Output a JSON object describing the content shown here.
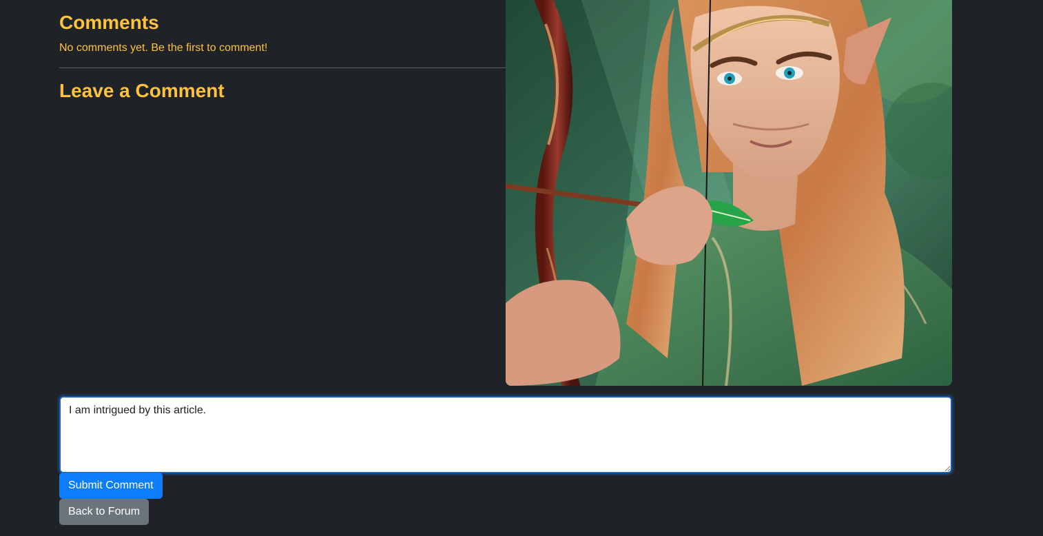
{
  "comments": {
    "title": "Comments",
    "empty_message": "No comments yet. Be the first to comment!"
  },
  "leave_comment": {
    "title": "Leave a Comment",
    "textarea_value": "I am intrigued by this article."
  },
  "buttons": {
    "submit_label": "Submit Comment",
    "back_label": "Back to Forum"
  },
  "colors": {
    "background": "#1f2328",
    "heading": "#ffc23d",
    "submit": "#0d7efb",
    "back": "#6b747b"
  },
  "image": {
    "icon": "elf-archer-illustration"
  }
}
